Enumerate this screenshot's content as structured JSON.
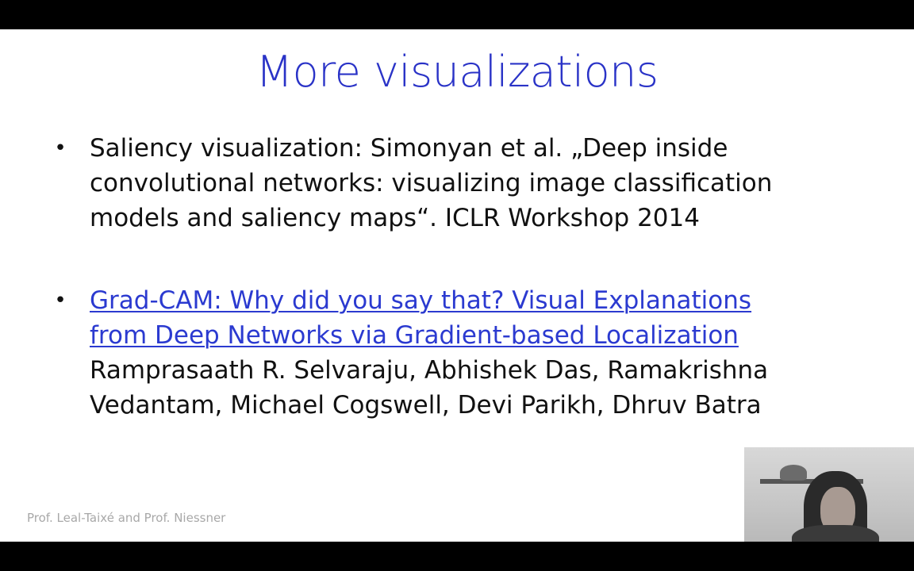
{
  "slide": {
    "title": "More visualizations",
    "bullets": [
      {
        "lines": [
          "Saliency visualization: Simonyan et al. „Deep inside",
          "convolutional networks: visualizing image classification",
          "models and saliency maps“. ICLR Workshop 2014"
        ]
      },
      {
        "link_lines": [
          "Grad-CAM: Why did you say that? Visual Explanations",
          "from Deep Networks via Gradient-based Localization"
        ],
        "lines": [
          "Ramprasaath R. Selvaraju, Abhishek Das, Ramakrishna",
          "Vedantam, Michael Cogswell, Devi Parikh, Dhruv Batra"
        ]
      }
    ],
    "footer": "Prof. Leal-Taixé and Prof. Niessner"
  },
  "colors": {
    "title": "#2a33c7",
    "link": "#2b3ad0",
    "footer": "#a8a8a8",
    "letterbox": "#000000"
  }
}
